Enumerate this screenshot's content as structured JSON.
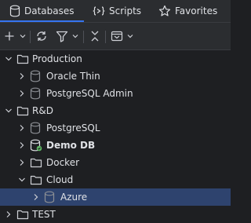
{
  "tabs": [
    {
      "label": "Databases",
      "icon": "database-icon",
      "active": true
    },
    {
      "label": "Scripts",
      "icon": "script-icon",
      "active": false
    },
    {
      "label": "Favorites",
      "icon": "star-icon",
      "active": false
    }
  ],
  "toolbar": {
    "add": "add-icon",
    "refresh": "refresh-icon",
    "filter": "filter-icon",
    "collapse": "collapse-all-icon",
    "options": "options-icon"
  },
  "tree": [
    {
      "label": "Production",
      "type": "folder",
      "expanded": true
    },
    {
      "label": "Oracle Thin",
      "type": "database",
      "expanded": false
    },
    {
      "label": "PostgreSQL Admin",
      "type": "database",
      "expanded": false
    },
    {
      "label": "R&D",
      "type": "folder",
      "expanded": true
    },
    {
      "label": "PostgreSQL",
      "type": "database",
      "expanded": false
    },
    {
      "label": "Demo DB",
      "type": "database-connected",
      "expanded": false,
      "bold": true
    },
    {
      "label": "Docker",
      "type": "folder",
      "expanded": false
    },
    {
      "label": "Cloud",
      "type": "folder",
      "expanded": true
    },
    {
      "label": "Azure",
      "type": "database",
      "expanded": false,
      "selected": true
    },
    {
      "label": "TEST",
      "type": "folder",
      "expanded": false
    }
  ],
  "colors": {
    "background": "#1e1f22",
    "panel": "#2b2d30",
    "accent": "#3574f0",
    "selection": "#2e436e",
    "connected": "#5fb865"
  }
}
